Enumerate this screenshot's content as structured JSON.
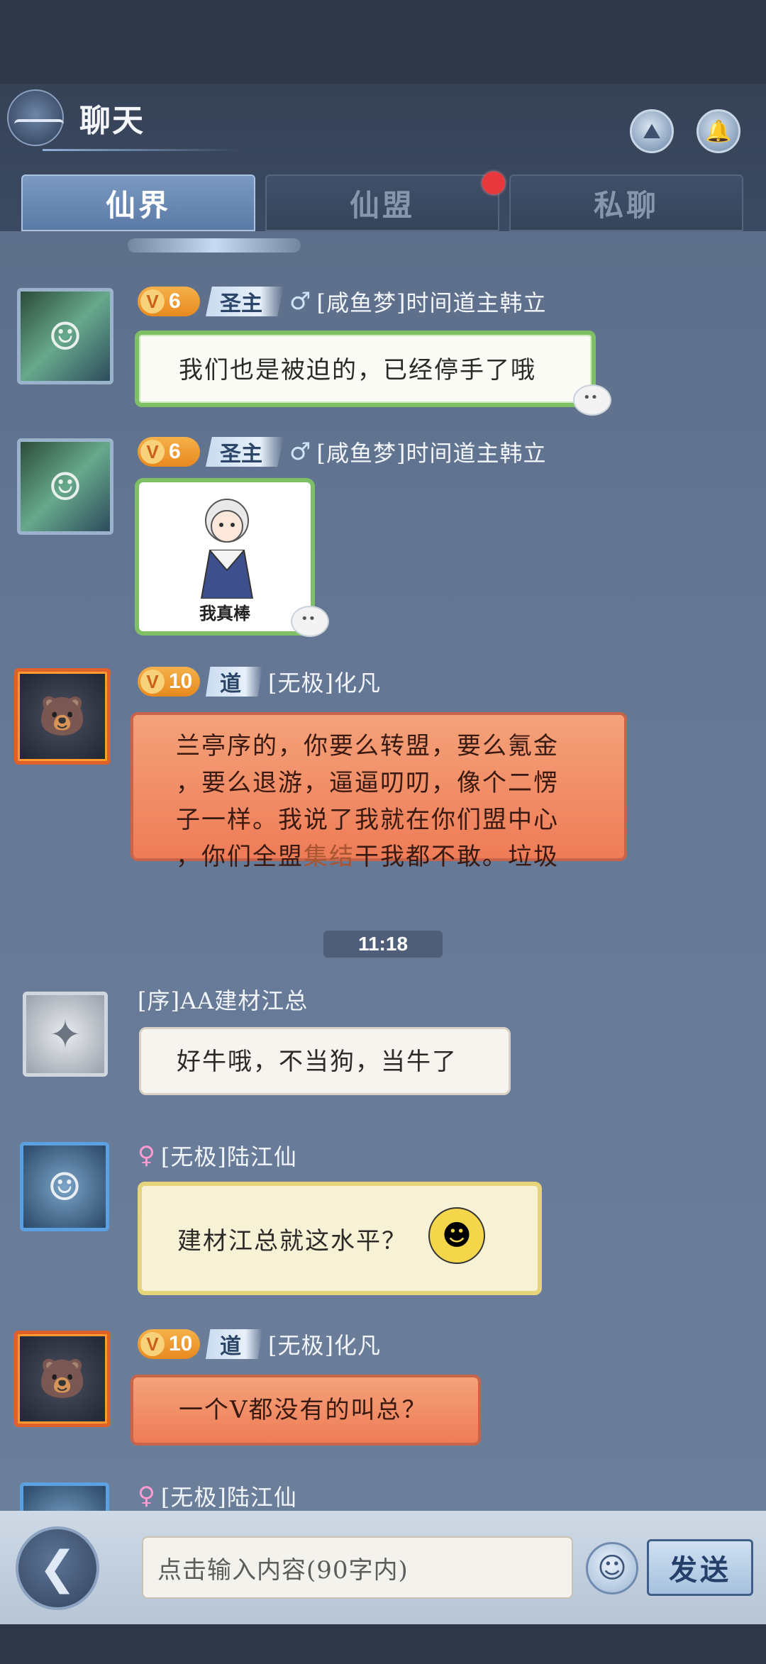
{
  "header": {
    "title": "聊天",
    "buttons": [
      {
        "name": "guild-icon"
      },
      {
        "name": "bell-icon"
      }
    ]
  },
  "tabs": [
    {
      "label": "仙界",
      "active": true
    },
    {
      "label": "仙盟",
      "active": false,
      "badge": true
    },
    {
      "label": "私聊",
      "active": false
    }
  ],
  "messages": [
    {
      "vip": "6",
      "rank": "圣主",
      "gender": "♂",
      "name": "[咸鱼梦]时间道主韩立",
      "text": "我们也是被迫的，已经停手了哦",
      "style": "green"
    },
    {
      "vip": "6",
      "rank": "圣主",
      "gender": "♂",
      "name": "[咸鱼梦]时间道主韩立",
      "sticker_caption": "我真棒",
      "style": "sticker"
    },
    {
      "vip": "10",
      "rank": "道",
      "name": "[无极]化凡",
      "lines": [
        "兰亭序的，你要么转盟，要么氪金",
        "，要么退游，逼逼叨叨，像个二愣",
        "子一样。我说了我就在你们盟中心"
      ],
      "line4_pre": "，你们全盟",
      "line4_hl": "集结",
      "line4_post": "干我都不敢。垃圾",
      "style": "fire"
    },
    {
      "name": "[序]AA建材江总",
      "text": "好牛哦，不当狗，当牛了",
      "style": "plain"
    },
    {
      "gender": "♀",
      "name": "[无极]陆江仙",
      "text": "建材江总就这水平？",
      "style": "gold"
    },
    {
      "vip": "10",
      "rank": "道",
      "name": "[无极]化凡",
      "text": "一个V都没有的叫总？",
      "style": "fire"
    },
    {
      "gender": "♀",
      "name": "[无极]陆江仙"
    }
  ],
  "timestamp": "11:18",
  "footer": {
    "input_placeholder": "点击输入内容(90字内)",
    "send_label": "发送"
  },
  "colors": {
    "chat_background": "#657896",
    "tab_active": "#6a8ab4",
    "badge": "#e8383c",
    "vip_badge": "#ee9b30"
  }
}
